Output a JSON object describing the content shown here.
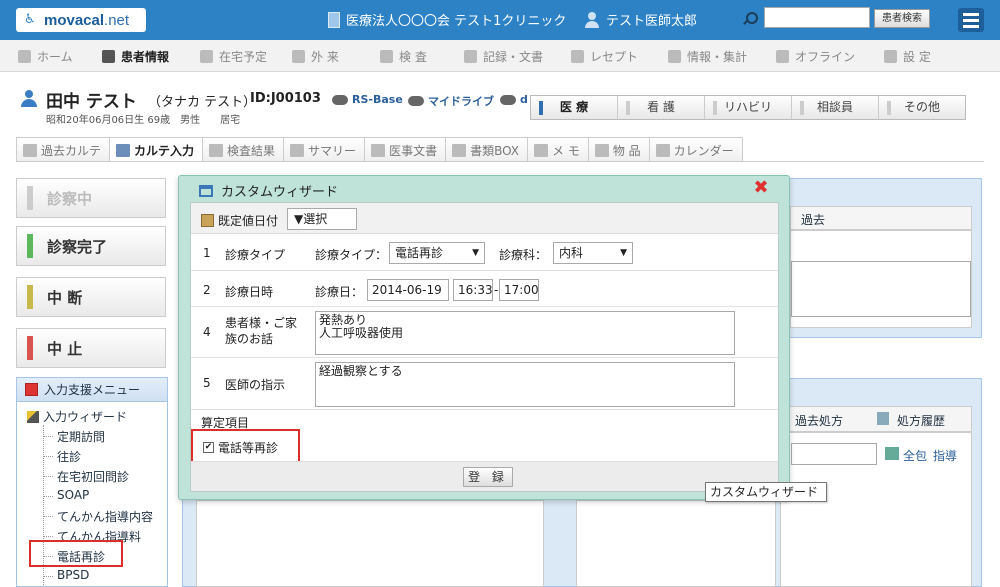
{
  "header": {
    "logo_text": "movacal",
    "logo_suffix": ".net",
    "organization": "医療法人〇〇〇会 テスト1クリニック",
    "doctor": "テスト医師太郎",
    "search_button": "患者検索",
    "search_placeholder": ""
  },
  "nav": [
    {
      "label": "ホーム",
      "active": false
    },
    {
      "label": "患者情報",
      "active": true
    },
    {
      "label": "在宅予定",
      "active": false
    },
    {
      "label": "外 来",
      "active": false
    },
    {
      "label": "検 査",
      "active": false
    },
    {
      "label": "記録・文書",
      "active": false
    },
    {
      "label": "レセプト",
      "active": false
    },
    {
      "label": "情報・集計",
      "active": false
    },
    {
      "label": "オフライン",
      "active": false
    },
    {
      "label": "設 定",
      "active": false
    }
  ],
  "patient": {
    "name": "田中 テスト",
    "kana": "（タナカ テスト）",
    "id": "ID:J00103",
    "sub": "昭和20年06月06日生 69歳　男性　　居宅",
    "links": [
      "RS-Base",
      "マイドライブ",
      "d"
    ]
  },
  "role_tabs": [
    "医 療",
    "看 護",
    "リハビリ",
    "相談員",
    "その他"
  ],
  "subtabs": [
    "過去カルテ",
    "カルテ入力",
    "検査結果",
    "サマリー",
    "医事文書",
    "書類BOX",
    "メ モ",
    "物 品",
    "カレンダー"
  ],
  "status_buttons": [
    {
      "label": "診察中",
      "color": "#cccccc",
      "disabled": true
    },
    {
      "label": "診察完了",
      "color": "#5cb85c",
      "disabled": false
    },
    {
      "label": "中 断",
      "color": "#c9b94a",
      "disabled": false
    },
    {
      "label": "中 止",
      "color": "#d9534f",
      "disabled": false
    }
  ],
  "support_menu": {
    "title": "入力支援メニュー",
    "root": "入力ウィザード",
    "items": [
      "定期訪問",
      "往診",
      "在宅初回問診",
      "SOAP",
      "てんかん指導内容",
      "てんかん指導料",
      "電話再診",
      "BPSD"
    ]
  },
  "right_panel": {
    "past_label": "過去",
    "past_rx": "過去処方",
    "rx_history": "処方履歴",
    "link_all": "全包",
    "link_guide": "指導"
  },
  "dialog": {
    "title": "カスタムウィザード",
    "default_date_label": "既定値日付",
    "select_label": "▼選択",
    "rows": [
      {
        "num": "1",
        "label": "診療タイプ"
      },
      {
        "num": "2",
        "label": "診療日時"
      },
      {
        "num": "4",
        "label": "患者様・ご家族のお話"
      },
      {
        "num": "5",
        "label": "医師の指示"
      }
    ],
    "type_label": "診療タイプ：",
    "type_value": "電話再診",
    "dept_label": "診療科：",
    "dept_value": "内科",
    "date_label": "診療日：",
    "date_value": "2014-06-19",
    "time_from": "16:33",
    "time_sep": "-",
    "time_to": "17:00",
    "story_text": "発熱あり\n人工呼吸器使用",
    "instruction_text": "経過観察とする",
    "calc_label": "算定項目",
    "calc_item": "電話等再診",
    "register_button": "登 録"
  },
  "tooltip": "カスタムウィザード"
}
